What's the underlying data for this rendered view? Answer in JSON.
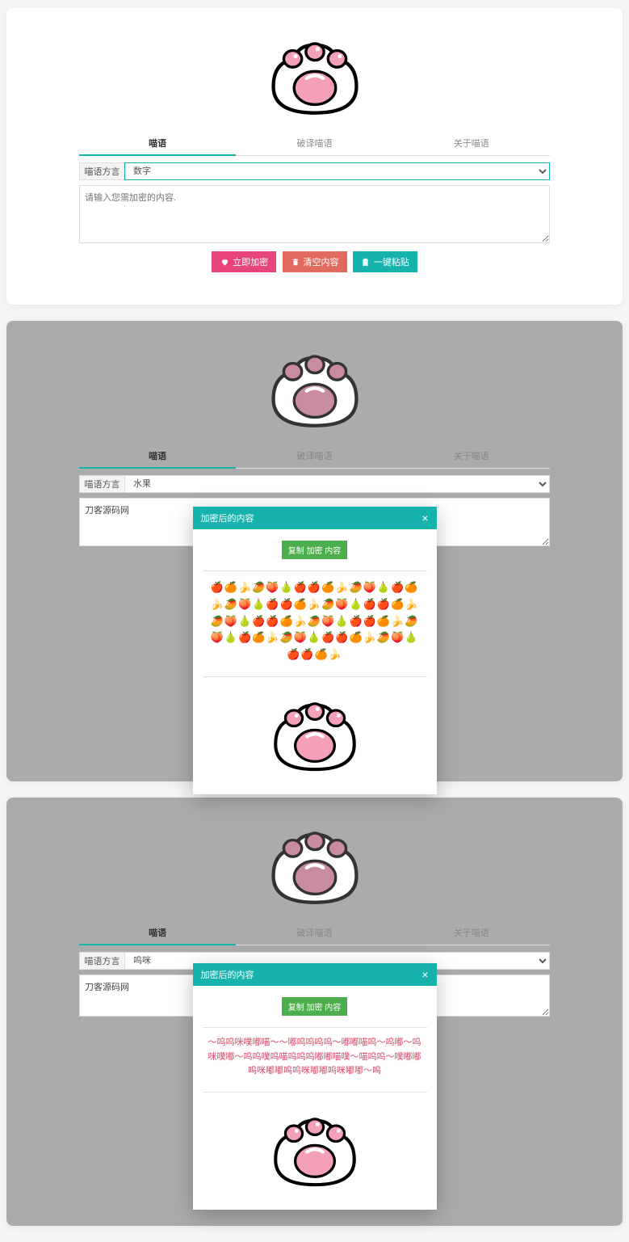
{
  "tabs": {
    "encrypt": "喵语",
    "decrypt": "破译喵语",
    "about": "关于喵语"
  },
  "form": {
    "dialect_label": "喵语方言"
  },
  "panel1": {
    "dialect_value": "数字",
    "placeholder": "请输入您需加密的内容.",
    "btn_encrypt": "立即加密",
    "btn_clear": "清空内容",
    "btn_paste": "一键粘贴"
  },
  "panel2": {
    "dialect_value": "水果",
    "text_value": "刀客源码网",
    "modal_title": "加密后的内容",
    "modal_copy": "复制 加密 内容",
    "cipher": "🍎🍊🍌🥭🍑🍐🍎🍎🍊🍌🥭🍑🍐🍎🍊🍌🥭🍑🍐🍎🍎🍊🍌🥭🍑🍐🍎🍎🍊🍌🥭🍑🍐🍎🍎🍊🍌🥭🍑🍐🍎🍎🍊🍌🥭🍑🍐🍎🍊🍌🥭🍑🍐🍎🍎🍊🍌🥭🍑🍐🍎🍎🍊🍌"
  },
  "panel3": {
    "dialect_value": "呜咪",
    "text_value": "刀客源码网",
    "modal_title": "加密后的内容",
    "modal_copy": "复制 加密 内容",
    "cipher": "～呜呜咪噗嘟喵～～嘟呜呜呜呜～嘟嘟喵呜～呜嘟～呜咪噗嘟～呜呜噗呜喵呜呜呜嘟嘟喵噗～喵呜呜～噗嘟嘟呜咪嘟嘟呜呜咪嘟嘟呜咪嘟嘟～呜"
  }
}
